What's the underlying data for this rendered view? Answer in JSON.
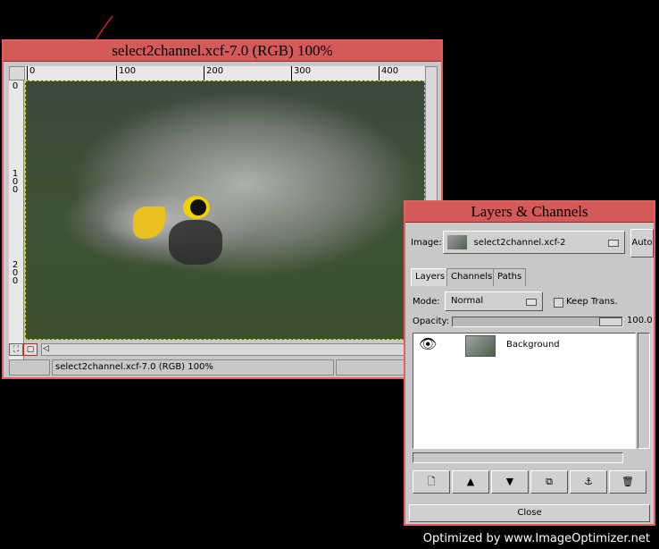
{
  "image_window": {
    "title": "select2channel.xcf-7.0 (RGB) 100%",
    "ruler_top_ticks": [
      "0",
      "100",
      "200",
      "300",
      "400"
    ],
    "ruler_left_ticks": [
      "0",
      "1\n0\n0",
      "2\n0\n0"
    ],
    "status_text": "select2channel.xcf-7.0 (RGB) 100%"
  },
  "layers_window": {
    "title": "Layers & Channels",
    "image_label": "Image:",
    "image_selected": "select2channel.xcf-2",
    "auto_button": "Auto",
    "tabs": [
      {
        "label": "Layers",
        "active": true
      },
      {
        "label": "Channels",
        "active": false
      },
      {
        "label": "Paths",
        "active": false
      }
    ],
    "mode_label": "Mode:",
    "mode_value": "Normal",
    "keep_trans_label": "Keep Trans.",
    "opacity_label": "Opacity:",
    "opacity_value": "100.0",
    "opacity_fraction": 1.0,
    "layers": [
      {
        "name": "Background",
        "visible": true
      }
    ],
    "toolbar_icons": [
      "new-layer-icon",
      "raise-layer-icon",
      "lower-layer-icon",
      "duplicate-layer-icon",
      "anchor-icon",
      "trash-icon"
    ],
    "close_button": "Close"
  },
  "footer_text": "Optimized by www.ImageOptimizer.net",
  "colors": {
    "title_bar": "#d45a5a",
    "window_border": "#e06060",
    "annotation_arrow": "#d02020"
  }
}
